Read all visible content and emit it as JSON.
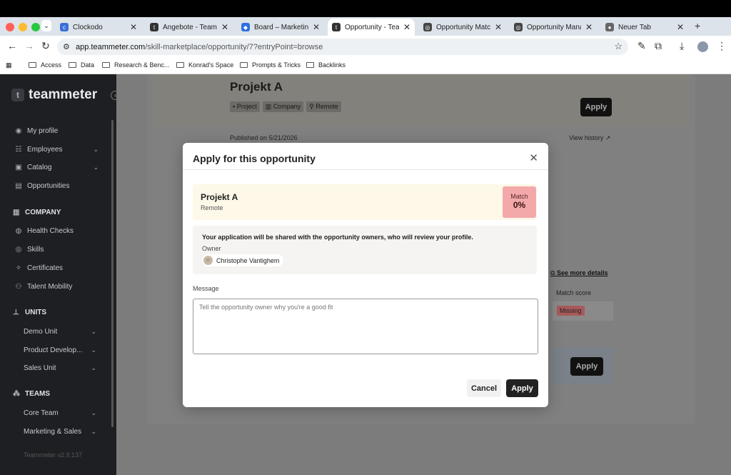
{
  "browser": {
    "tabs": [
      {
        "title": "Clockodo",
        "fav_color": "#3a6fd8"
      },
      {
        "title": "Angebote - Teammeter",
        "fav_color": "#333333"
      },
      {
        "title": "Board – Marketing Team",
        "fav_color": "#2f6fe0"
      },
      {
        "title": "Opportunity - Teammeter",
        "fav_color": "#333333"
      },
      {
        "title": "Opportunity Matching",
        "fav_color": "#444444"
      },
      {
        "title": "Opportunity Management",
        "fav_color": "#444444"
      },
      {
        "title": "Neuer Tab",
        "fav_color": "#666666"
      }
    ],
    "active_tab_index": 3,
    "url_host": "app.teammeter.com",
    "url_path": "/skill-marketplace/opportunity/7?entryPoint=browse",
    "bookmarks": [
      "Access",
      "Data",
      "Research & Benc...",
      "Konrad's Space",
      "Prompts & Tricks",
      "Backlinks"
    ]
  },
  "sidebar": {
    "logo": "teammeter",
    "items": [
      {
        "label": "My profile"
      },
      {
        "label": "Employees"
      },
      {
        "label": "Catalog"
      },
      {
        "label": "Opportunities"
      }
    ],
    "company_section": "COMPANY",
    "company_items": [
      {
        "label": "Health Checks"
      },
      {
        "label": "Skills"
      },
      {
        "label": "Certificates"
      },
      {
        "label": "Talent Mobility"
      }
    ],
    "units_section": "UNITS",
    "units_items": [
      {
        "label": "Demo Unit"
      },
      {
        "label": "Product Develop..."
      },
      {
        "label": "Sales Unit"
      }
    ],
    "teams_section": "TEAMS",
    "teams_items": [
      {
        "label": "Core Team"
      },
      {
        "label": "Marketing & Sales"
      }
    ],
    "version": "Teammeter v2.9.137"
  },
  "background": {
    "title": "Projekt A",
    "chips": [
      "Project",
      "Company",
      "Remote"
    ],
    "apply": "Apply",
    "published": "Published on 5/21/2026",
    "view_history": "View history ↗",
    "see_more": "See more details",
    "match_score": "Match score",
    "missing": "Missing",
    "apply2": "Apply"
  },
  "modal": {
    "title": "Apply for this opportunity",
    "opportunity_title": "Projekt A",
    "opportunity_sub": "Remote",
    "match_label": "Match",
    "match_value": "0%",
    "info_text": "Your application will be shared with the opportunity owners, who will review your profile.",
    "owner_label": "Owner",
    "owner_name": "Christophe Vantighem",
    "message_label": "Message",
    "message_placeholder": "Tell the opportunity owner why you're a good fit",
    "cancel": "Cancel",
    "apply": "Apply"
  }
}
